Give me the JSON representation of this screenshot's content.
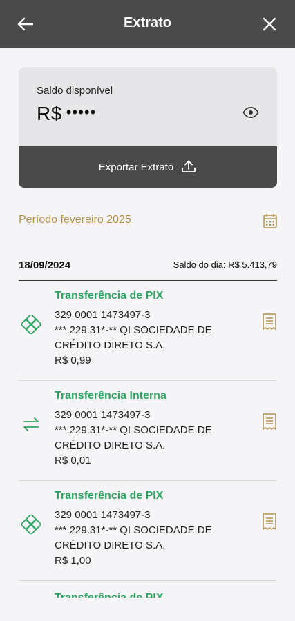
{
  "header": {
    "title": "Extrato",
    "back_icon": "arrow-left-icon",
    "close_icon": "close-icon"
  },
  "balance": {
    "label": "Saldo disponível",
    "currency": "R$",
    "masked_value": "•••••",
    "toggle_icon": "eye-icon",
    "export_label": "Exportar Extrato",
    "export_icon": "upload-tray-icon"
  },
  "period": {
    "prefix": "Período",
    "month": "fevereiro 2025",
    "icon": "calendar-icon"
  },
  "day": {
    "date": "18/09/2024",
    "balance_label": "Saldo do dia: R$ 5.413,79"
  },
  "transactions": [
    {
      "title": "Transferência de PIX",
      "account": "329 0001 1473497-3",
      "counterpart_line1": "***.229.31*-** QI SOCIEDADE DE",
      "counterpart_line2": "CRÉDITO DIRETO S.A.",
      "amount": "R$ 0,99",
      "icon": "pix-icon"
    },
    {
      "title": "Transferência Interna",
      "account": "329 0001 1473497-3",
      "counterpart_line1": "***.229.31*-** QI SOCIEDADE DE",
      "counterpart_line2": "CRÉDITO DIRETO S.A.",
      "amount": "R$ 0,01",
      "icon": "transfer-arrows-icon"
    },
    {
      "title": "Transferência de PIX",
      "account": "329 0001 1473497-3",
      "counterpart_line1": "***.229.31*-** QI SOCIEDADE DE",
      "counterpart_line2": "CRÉDITO DIRETO S.A.",
      "amount": "R$ 1,00",
      "icon": "pix-icon"
    },
    {
      "title": "Transferência de PIX"
    }
  ],
  "colors": {
    "header": "#4a4a4a",
    "accent_green": "#2fa563",
    "gold": "#b0914a"
  }
}
